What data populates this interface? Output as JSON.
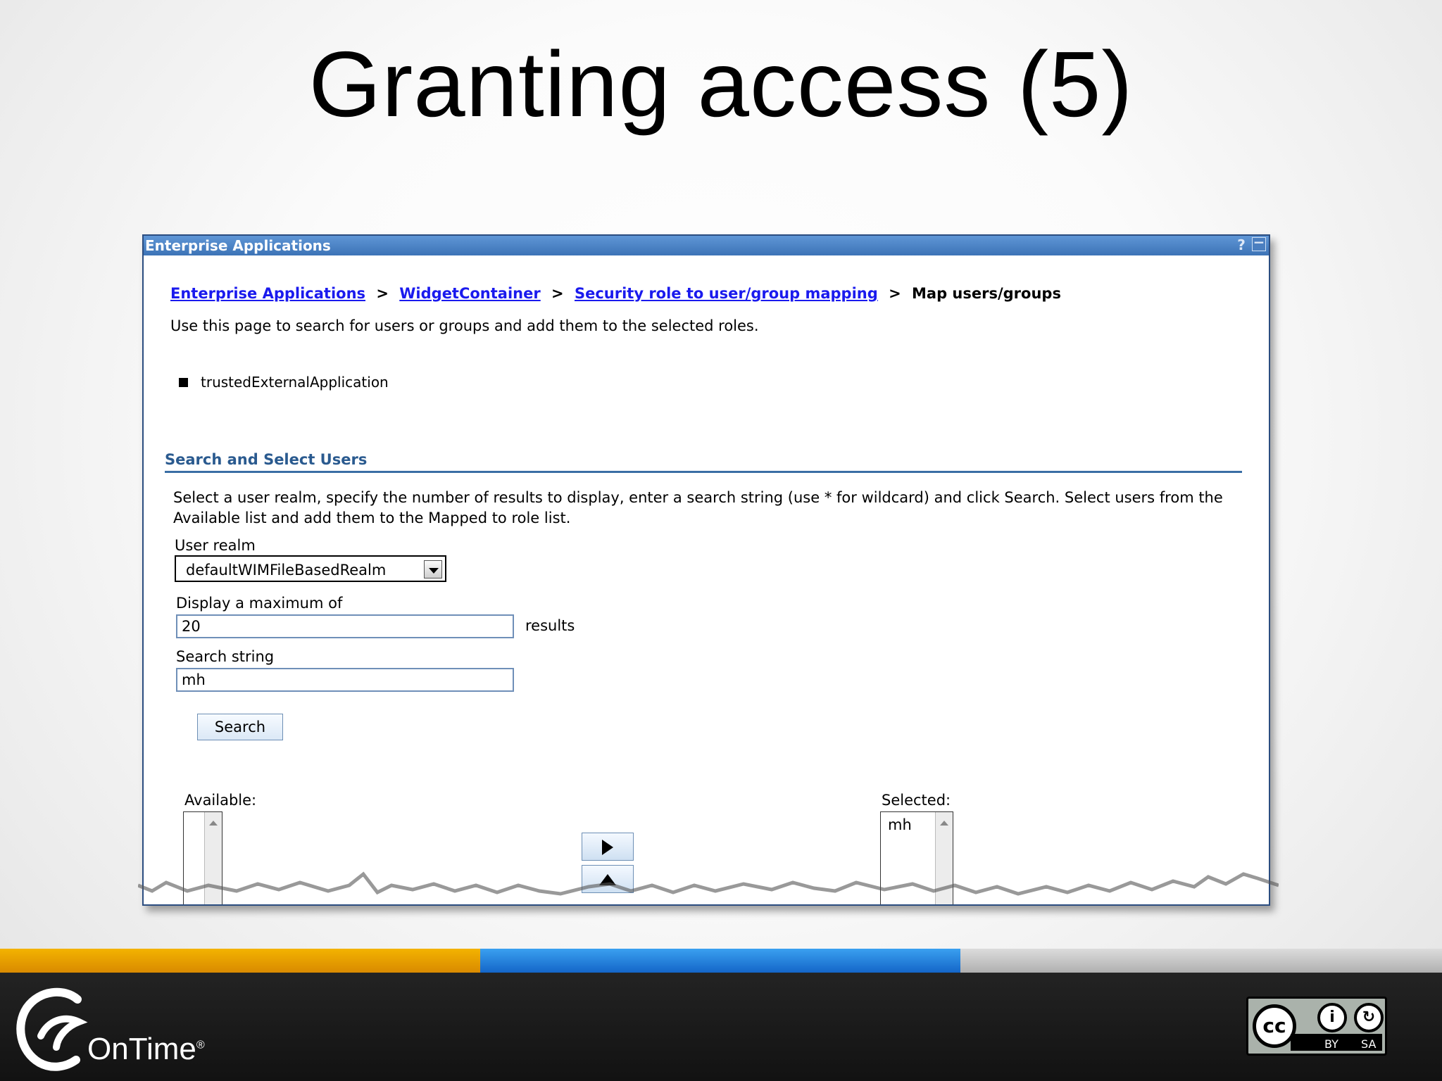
{
  "slide": {
    "title": "Granting access (5)"
  },
  "panel": {
    "title": "Enterprise Applications",
    "help_glyph": "?",
    "minimize_glyph": "−",
    "breadcrumb": {
      "link1": "Enterprise Applications",
      "link2": "WidgetContainer",
      "link3": "Security role to user/group mapping",
      "sep": ">",
      "current": "Map users/groups"
    },
    "description": "Use this page to search for users or groups and add them to the selected roles.",
    "role": "trustedExternalApplication",
    "section_title": "Search and Select Users",
    "instructions": "Select a user realm, specify the number of results to display, enter a search string (use * for wildcard) and click Search. Select users from the Available list and add them to the Mapped to role list.",
    "user_realm_label": "User realm",
    "user_realm_value": "defaultWIMFileBasedRealm",
    "max_label": "Display a maximum of",
    "max_value": "20",
    "results_label": "results",
    "search_string_label": "Search string",
    "search_string_value": "mh",
    "search_button": "Search",
    "available_label": "Available:",
    "available_items": [],
    "selected_label": "Selected:",
    "selected_items": [
      "mh"
    ]
  },
  "footer": {
    "logo_text": "OnTime",
    "logo_mark": "®",
    "license": {
      "cc": "cc",
      "by": "BY",
      "sa": "SA"
    }
  },
  "colors": {
    "stripe_orange": "#e8a000",
    "stripe_blue": "#1f86e0",
    "stripe_gray": "#c4c4c4",
    "header_blue": "#4a80c4",
    "link_blue": "#1a1aee",
    "section_blue": "#2a5a8f"
  },
  "icons": [
    "help-icon",
    "minimize-icon",
    "dropdown-arrow-icon",
    "move-right-icon",
    "move-left-icon",
    "scroll-up-icon",
    "ontime-logo-icon",
    "cc-icon",
    "attribution-icon",
    "share-alike-icon"
  ]
}
